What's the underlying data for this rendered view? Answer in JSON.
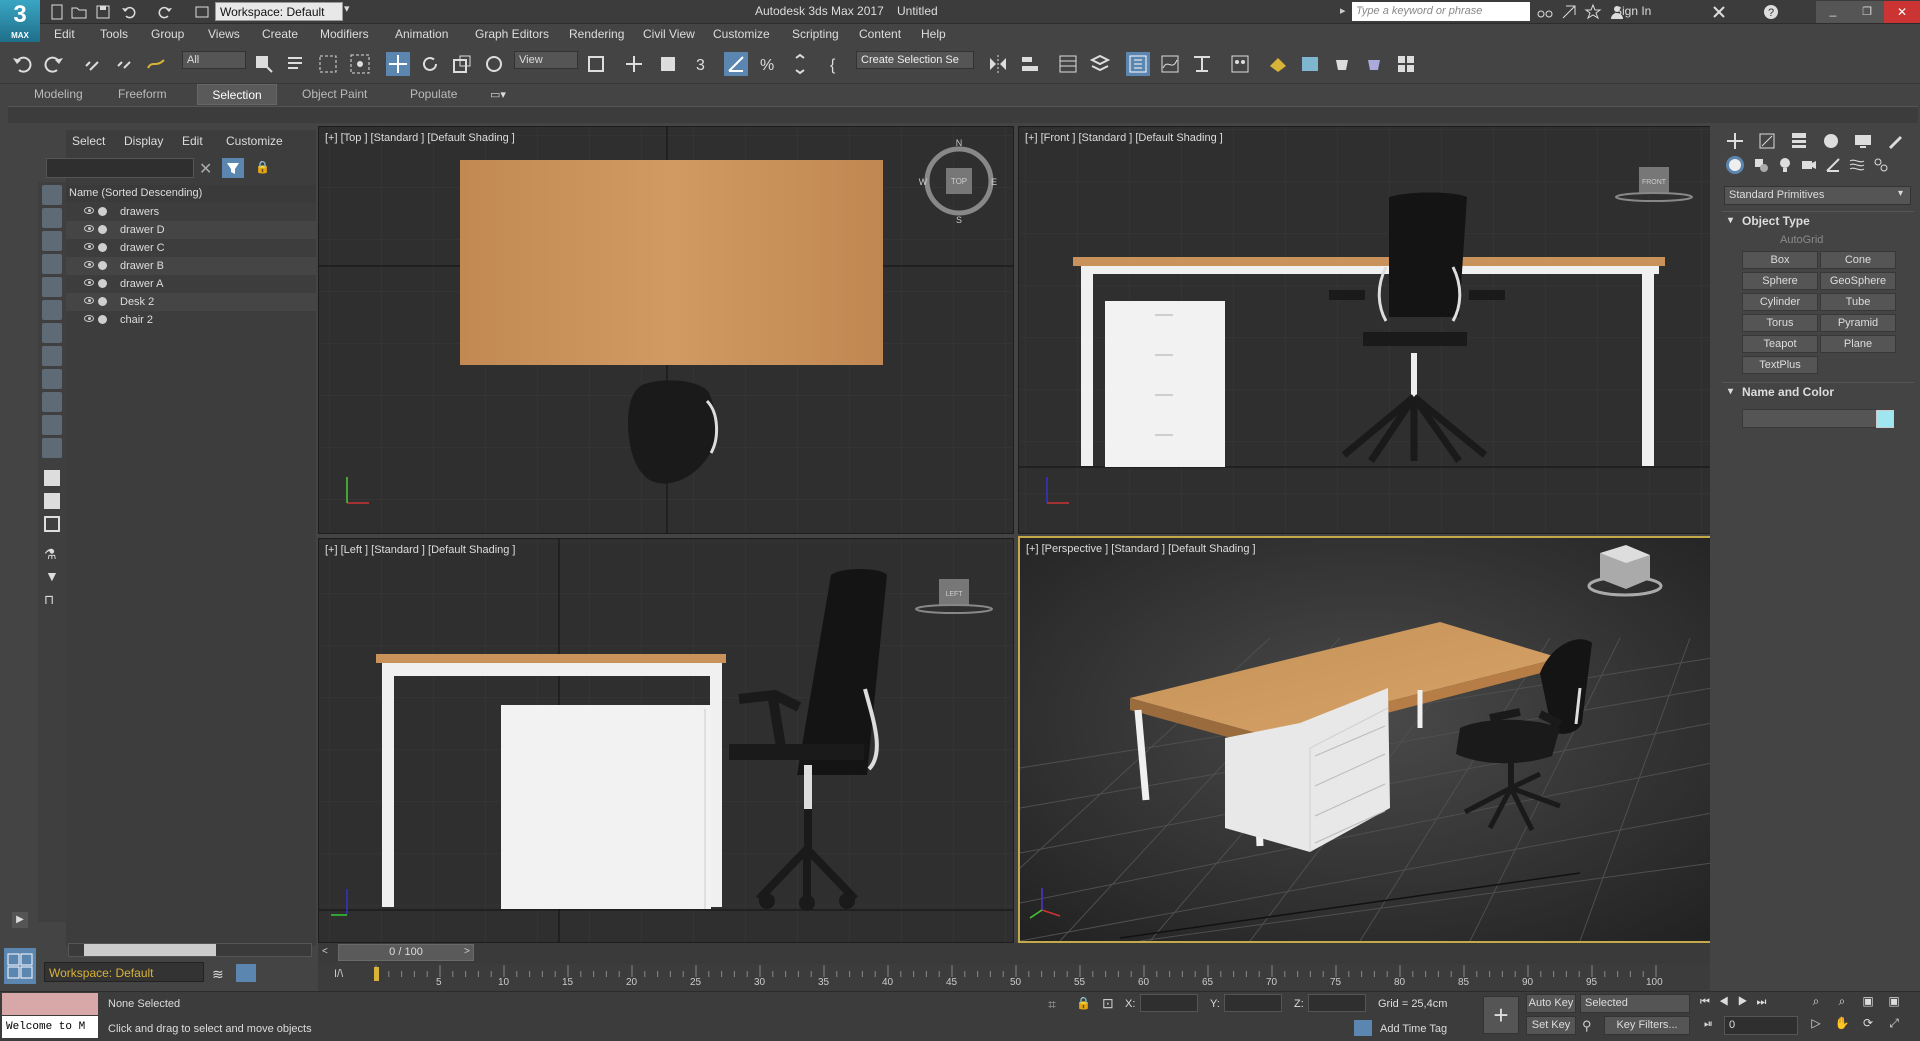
{
  "app": {
    "logo_text": "3",
    "logo_sub": "MAX",
    "title": "Autodesk 3ds Max 2017",
    "document": "Untitled",
    "workspace": "Workspace: Default",
    "search_placeholder": "Type a keyword or phrase",
    "sign_in": "Sign In"
  },
  "menu": [
    "Edit",
    "Tools",
    "Group",
    "Views",
    "Create",
    "Modifiers",
    "Animation",
    "Graph Editors",
    "Rendering",
    "Civil View",
    "Customize",
    "Scripting",
    "Content",
    "Help"
  ],
  "toolbar": {
    "selection_filter": "All",
    "ref_coord": "View",
    "selection_set": "Create Selection Se"
  },
  "ribbon": {
    "tabs": [
      "Modeling",
      "Freeform",
      "Selection",
      "Object Paint",
      "Populate"
    ],
    "active": "Selection"
  },
  "scene_explorer": {
    "tabs": [
      "Select",
      "Display",
      "Edit",
      "Customize"
    ],
    "column_header": "Name (Sorted Descending)",
    "items": [
      "drawers",
      "drawer D",
      "drawer C",
      "drawer B",
      "drawer A",
      "Desk 2",
      "chair 2"
    ],
    "bottom_workspace": "Workspace: Default"
  },
  "viewports": [
    {
      "label": "[+] [Top ] [Standard ] [Default Shading ]",
      "view": "top",
      "cube": "TOP"
    },
    {
      "label": "[+] [Front ] [Standard ] [Default Shading ]",
      "view": "front",
      "cube": "FRONT"
    },
    {
      "label": "[+] [Left ] [Standard ] [Default Shading ]",
      "view": "left",
      "cube": "LEFT"
    },
    {
      "label": "[+] [Perspective ] [Standard ] [Default Shading ]",
      "view": "perspective",
      "cube": ""
    }
  ],
  "compass": {
    "n": "N",
    "s": "S",
    "w": "W",
    "e": "E"
  },
  "timeline": {
    "frame": "0 / 100",
    "ticks": [
      "5",
      "10",
      "15",
      "20",
      "25",
      "30",
      "35",
      "40",
      "45",
      "50",
      "55",
      "60",
      "65",
      "70",
      "75",
      "80",
      "85",
      "90",
      "95",
      "100"
    ],
    "marker": "I/\\"
  },
  "status": {
    "selection": "None Selected",
    "prompt": "Click and drag to select and move objects",
    "maxscript": "Welcome to M",
    "x": "X:",
    "y": "Y:",
    "z": "Z:",
    "grid": "Grid = 25,4cm",
    "add_time_tag": "Add Time Tag",
    "auto_key": "Auto Key",
    "set_key": "Set Key",
    "selected": "Selected",
    "key_filters": "Key Filters...",
    "frame": "0"
  },
  "command_panel": {
    "dropdown": "Standard Primitives",
    "object_type": "Object Type",
    "autogrid": "AutoGrid",
    "buttons": [
      "Box",
      "Cone",
      "Sphere",
      "GeoSphere",
      "Cylinder",
      "Tube",
      "Torus",
      "Pyramid",
      "Teapot",
      "Plane",
      "TextPlus"
    ],
    "name_color": "Name and Color",
    "swatch_color": "#a0e6f0"
  },
  "colors": {
    "wood": "#c8925a",
    "active_border": "#c4a94a",
    "accent": "#5b86b0"
  }
}
